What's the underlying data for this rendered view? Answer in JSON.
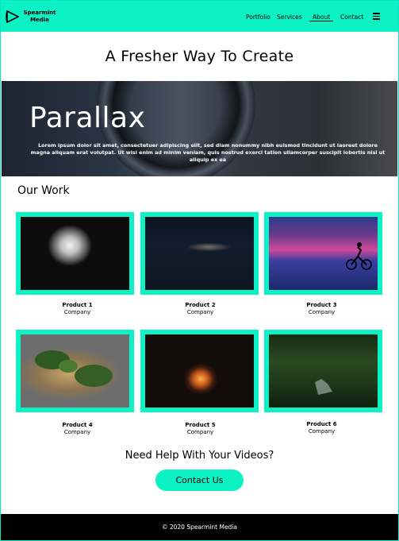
{
  "nav": {
    "brand_line1": "Spearmint",
    "brand_line2": "Media",
    "links": [
      {
        "label": "Portfolio"
      },
      {
        "label": "Services"
      },
      {
        "label": "About"
      },
      {
        "label": "Contact"
      }
    ],
    "active_link": "About",
    "menu_icon": "hamburger-icon"
  },
  "headline": "A Fresher Way To Create",
  "hero": {
    "title": "Parallax",
    "text": "Lorem ipsum dolor sit amet, consectetuer adipiscing elit, sed diam nonummy nibh euismod tincidunt ut laoreet dolore magna aliquam erat volutpat. Ut wisi enim ad minim veniam, quis nostrud exerci tation ullamcorper suscipit lobortis nisl ut aliquip ex ea"
  },
  "work": {
    "title": "Our Work",
    "items": [
      {
        "product": "Product 1",
        "company": "Company"
      },
      {
        "product": "Product 2",
        "company": "Company"
      },
      {
        "product": "Product 3",
        "company": "Company"
      },
      {
        "product": "Product 4",
        "company": "Company"
      },
      {
        "product": "Product 5",
        "company": "Company"
      },
      {
        "product": "Product 6",
        "company": "Company"
      }
    ]
  },
  "cta": {
    "title": "Need Help With Your Videos?",
    "button": "Contact Us"
  },
  "footer": {
    "text": "© 2020 Spearmint Media"
  },
  "colors": {
    "accent": "#0df2c5",
    "footer_bg": "#000000"
  }
}
